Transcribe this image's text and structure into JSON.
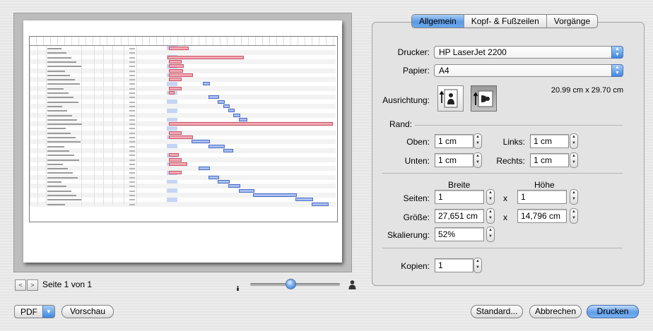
{
  "tabs": [
    "Allgemein",
    "Kopf- & Fußzeilen",
    "Vorgänge"
  ],
  "active_tab": "Allgemein",
  "printer": {
    "label": "Drucker:",
    "value": "HP LaserJet 2200"
  },
  "paper": {
    "label": "Papier:",
    "value": "A4",
    "dimensions": "20.99 cm x 29.70 cm"
  },
  "orientation": {
    "label": "Ausrichtung:",
    "selected": "landscape"
  },
  "margins": {
    "header": "Rand:",
    "top_label": "Oben:",
    "top": "1 cm",
    "left_label": "Links:",
    "left": "1 cm",
    "bottom_label": "Unten:",
    "bottom": "1 cm",
    "right_label": "Rechts:",
    "right": "1 cm"
  },
  "pages": {
    "width_header": "Breite",
    "height_header": "Höhe",
    "pages_label": "Seiten:",
    "pages_width": "1",
    "pages_height": "1",
    "size_label": "Größe:",
    "size_width": "27,651 cm",
    "size_height": "14,796 cm",
    "times": "x",
    "scale_label": "Skalierung:",
    "scale": "52%"
  },
  "copies": {
    "label": "Kopien:",
    "value": "1"
  },
  "preview": {
    "page_indicator": "Seite 1 von 1",
    "prev": "<",
    "next": ">"
  },
  "buttons": {
    "pdf": "PDF",
    "preview": "Vorschau",
    "defaults": "Standard...",
    "cancel": "Abbrechen",
    "print": "Drucken"
  },
  "colors": {
    "accent": "#5a9ae6",
    "bar_red": "#f2a9b4",
    "bar_blue": "#a9bff2"
  }
}
